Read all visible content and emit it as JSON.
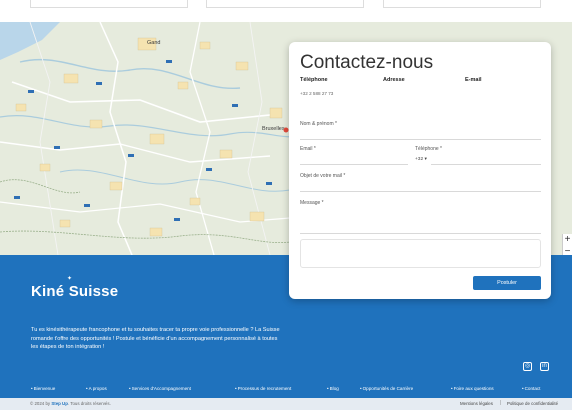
{
  "map": {
    "labels": [
      "Gand",
      "Bruxelles"
    ]
  },
  "contact": {
    "title": "Contactez-nous",
    "phone_label": "Téléphone",
    "phone_value": "+32 2 588 27 73",
    "address_label": "Adresse",
    "address_value": "",
    "email_label": "E-mail",
    "email_value": "",
    "fields": {
      "name_label": "Nom & prénom *",
      "name_placeholder": "",
      "email_label": "Email *",
      "email_placeholder": "",
      "phone_label": "Téléphone *",
      "phone_prefix": "+32 ▾",
      "phone_placeholder": "",
      "subject_label": "Objet de votre mail *",
      "subject_placeholder": "",
      "message_label": "Message *",
      "message_placeholder": ""
    },
    "upload_link": "",
    "upload_text": "",
    "upload_hint": "",
    "submit_label": "Postuler"
  },
  "footer": {
    "brand_left": "Kiné",
    "brand_right": "Suisse",
    "pitch": "Tu es kinésithérapeute francophone et tu souhaites tracer ta propre voie professionnelle ? La Suisse romande t'offre des opportunités ! Postule et bénéficie d'un accompagnement personnalisé à toutes les étapes de ton intégration !",
    "social_icons": [
      "instagram-icon",
      "linkedin-icon"
    ],
    "nav": [
      "Bienvenue",
      "A propos",
      "Services d'Accompagnement",
      "Processus de recrutement",
      "Blog",
      "Opportunités de Carrière",
      "Foire aux questions",
      "Contact"
    ],
    "copyright_prefix": "© 2024 by",
    "copyright_brand": "Step Up",
    "copyright_suffix": ". Tous droits réservés.",
    "legal_notice": "Mentions légales",
    "privacy": "Politique de confidentialité"
  },
  "colors": {
    "brand_blue": "#1f72bd",
    "map_land": "#e6ebdd",
    "bottom_bar": "#e5ebf2"
  }
}
